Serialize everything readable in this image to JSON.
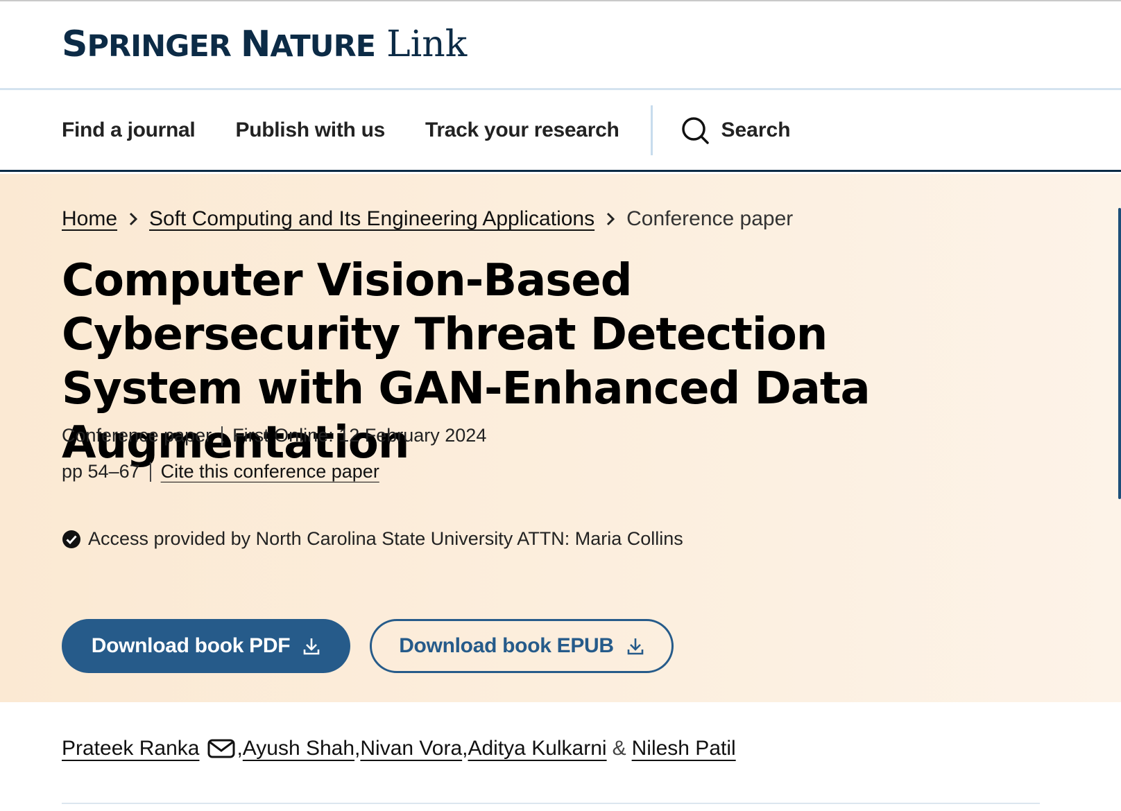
{
  "logo": {
    "brand_first_big": "S",
    "brand_first_rest": "PRINGER",
    "brand_second_big": "N",
    "brand_second_rest": "ATURE",
    "link_text": "Link",
    "color": "#0c2b46"
  },
  "nav": {
    "items": [
      "Find a journal",
      "Publish with us",
      "Track your research"
    ],
    "search_label": "Search"
  },
  "breadcrumb": {
    "home": "Home",
    "book": "Soft Computing and Its Engineering Applications",
    "current": "Conference paper"
  },
  "article": {
    "title": "Computer Vision-Based Cybersecurity Threat Detection System with GAN-Enhanced Data Augmentation",
    "type": "Conference paper",
    "first_online": "First Online: 12 February 2024",
    "pages": "pp 54–67",
    "cite_link": "Cite this conference paper",
    "access": "Access provided by North Carolina State University ATTN: Maria Collins"
  },
  "buttons": {
    "pdf": "Download book PDF",
    "epub": "Download book EPUB"
  },
  "authors": {
    "list": [
      "Prateek Ranka",
      "Ayush Shah",
      "Nivan Vora",
      "Aditya Kulkarni",
      "Nilesh Patil"
    ],
    "comma": ",",
    "ampersand": "&"
  },
  "colors": {
    "accent": "#265b8a",
    "hero_bg": "#fcefdf",
    "nav_border": "#0c2b46"
  }
}
